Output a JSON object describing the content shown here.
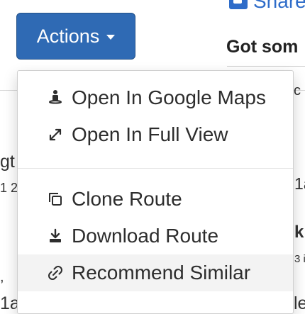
{
  "header": {
    "share_label": "Share",
    "title": "Got som"
  },
  "actions_button": {
    "label": "Actions"
  },
  "dropdown": {
    "items": [
      {
        "label": "Open In Google Maps",
        "icon": "street-view-icon"
      },
      {
        "label": "Open In Full View",
        "icon": "expand-icon"
      },
      {
        "label": "Clone Route",
        "icon": "clone-icon"
      },
      {
        "label": "Download Route",
        "icon": "download-icon"
      },
      {
        "label": "Recommend Similar",
        "icon": "link-icon"
      }
    ]
  },
  "background": {
    "left_fragments": [
      "gt",
      "1 2",
      ",",
      "1a"
    ],
    "right_fragments": [
      "c",
      "1a",
      "k",
      "3 i",
      "le"
    ]
  }
}
